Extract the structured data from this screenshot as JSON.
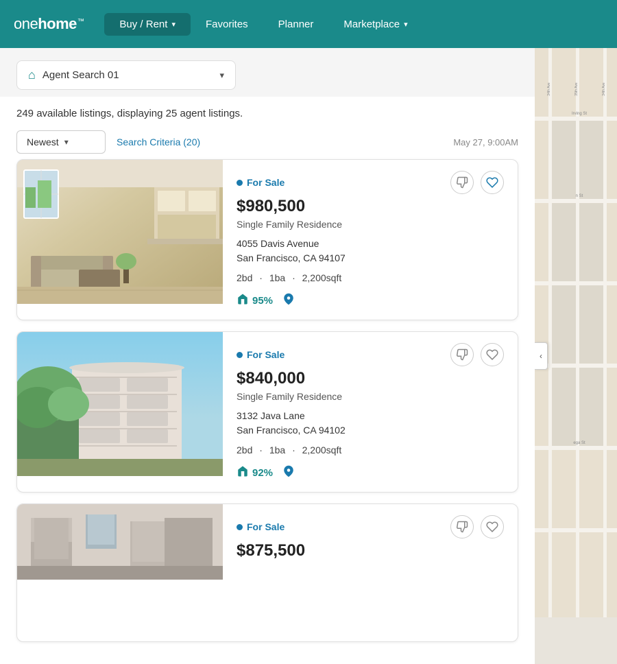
{
  "header": {
    "logo_light": "one",
    "logo_bold": "home",
    "nav": [
      {
        "label": "Buy / Rent",
        "has_dropdown": true,
        "active": true
      },
      {
        "label": "Favorites",
        "has_dropdown": false,
        "active": false
      },
      {
        "label": "Planner",
        "has_dropdown": false,
        "active": false
      },
      {
        "label": "Marketplace",
        "has_dropdown": true,
        "active": false
      }
    ]
  },
  "search_bar": {
    "label": "Agent Search 01",
    "placeholder": "Agent Search 01"
  },
  "listings": {
    "summary": "249 available listings, displaying 25 agent listings.",
    "sort_label": "Newest",
    "search_criteria_label": "Search Criteria (20)",
    "timestamp": "May 27, 9:00AM",
    "cards": [
      {
        "status": "For Sale",
        "price": "$980,500",
        "type": "Single Family Residence",
        "address_line1": "4055  Davis Avenue",
        "address_line2": "San Francisco, CA 94107",
        "beds": "2bd",
        "baths": "1ba",
        "sqft": "2,200sqft",
        "match": "95%",
        "image_type": "kitchen"
      },
      {
        "status": "For Sale",
        "price": "$840,000",
        "type": "Single Family Residence",
        "address_line1": "3132  Java Lane",
        "address_line2": "San Francisco, CA 94102",
        "beds": "2bd",
        "baths": "1ba",
        "sqft": "2,200sqft",
        "match": "92%",
        "image_type": "apartment"
      },
      {
        "status": "For Sale",
        "price": "$875,500",
        "type": "",
        "address_line1": "",
        "address_line2": "",
        "beds": "",
        "baths": "",
        "sqft": "",
        "match": "",
        "image_type": "building"
      }
    ]
  },
  "map": {
    "toggle_icon": "‹",
    "street_labels": [
      "Irving St",
      "n St",
      "ega St"
    ],
    "ave_labels": [
      "34th Ave",
      "35th Ave",
      "34th Ave"
    ]
  },
  "colors": {
    "header_bg": "#1a8a8a",
    "accent_blue": "#1a7aad",
    "accent_teal": "#1a8a8a",
    "status_dot": "#1a7aad"
  }
}
